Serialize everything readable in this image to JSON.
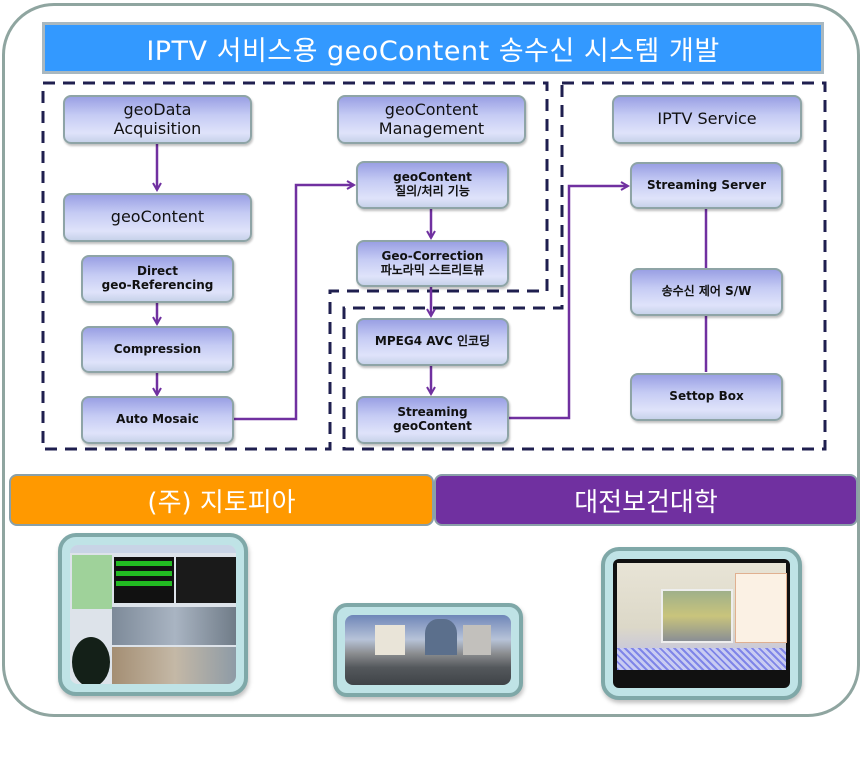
{
  "title": "IPTV 서비스용 geoContent  송수신 시스템 개발",
  "nodes": {
    "geodata_acquisition": "geoData\nAcquisition",
    "geocontent": "geoContent",
    "direct_georef": "Direct\ngeo-Referencing",
    "compression": "Compression",
    "auto_mosaic": "Auto Mosaic",
    "geocontent_management": "geoContent\nManagement",
    "query_processing": "geoContent\n질의/처리 기능",
    "geo_correction": "Geo-Correction\n파노라믹 스트리트뷰",
    "mpeg4_encoding": "MPEG4 AVC 인코딩",
    "streaming_geocontent": "Streaming\ngeoContent",
    "iptv_service": "IPTV Service",
    "streaming_server": "Streaming Server",
    "control_sw": "송수신 제어 S/W",
    "settop_box": "Settop Box"
  },
  "organizations": {
    "left": "(주) 지토피아",
    "right": "대전보건대학"
  },
  "images": [
    {
      "name": "mobile-mapping-software-screenshot"
    },
    {
      "name": "panoramic-street-view-image"
    },
    {
      "name": "iptv-map-display"
    }
  ],
  "colors": {
    "title_bar": "#3399ff",
    "org_left": "#ff9900",
    "org_right": "#7030a0",
    "arrow": "#7030a0",
    "dashed_border": "#1f1f4f"
  }
}
